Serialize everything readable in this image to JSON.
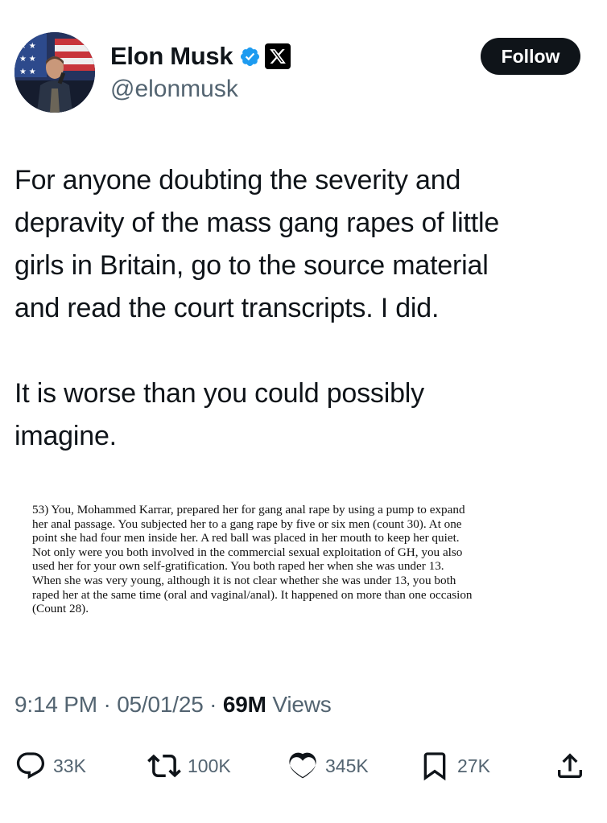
{
  "author": {
    "display_name": "Elon Musk",
    "handle": "@elonmusk",
    "verified_color": "#1d9bf0",
    "affiliation_badge": "x-logo-icon"
  },
  "follow_label": "Follow",
  "tweet": {
    "paragraphs": [
      [
        "For anyone doubting the severity and",
        "depravity of the mass gang rapes of little",
        "girls in Britain, go to the source material",
        "and read the court transcripts. I did."
      ],
      [
        "It is worse than you could possibly",
        "imagine."
      ]
    ]
  },
  "attached_document": {
    "lines": [
      "53)  You, Mohammed Karrar, prepared her for gang anal rape by using a pump to expand",
      "her anal passage.  You subjected her to a gang rape by five or six men (count 30). At one",
      "point she had four men inside her. A red ball was placed in her mouth to keep her quiet.",
      "Not only were you both involved in the commercial sexual exploitation of  GH, you also",
      "used her for your own self-gratification. You both raped her when she was under 13.",
      "When she was very young, although it is not clear whether she was under 13, you both",
      "raped her at the same time (oral and vaginal/anal). It happened on more than one occasion",
      "(Count 28)."
    ]
  },
  "meta": {
    "time": "9:14 PM",
    "separator": " · ",
    "date": "05/01/25",
    "views_count": "69M",
    "views_label": " Views"
  },
  "actions": {
    "replies": "33K",
    "reposts": "100K",
    "likes": "345K",
    "bookmarks": "27K"
  },
  "colors": {
    "text": "#0f1419",
    "secondary_text": "#536471",
    "verified": "#1d9bf0"
  }
}
